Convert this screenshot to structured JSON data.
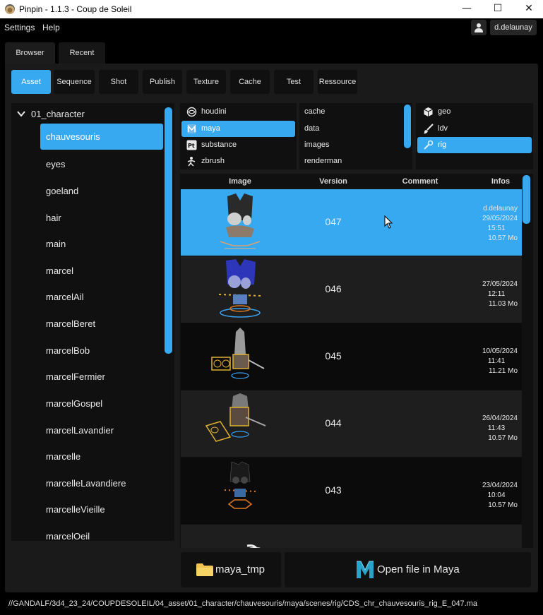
{
  "window": {
    "title": "Pinpin - 1.1.3 - Coup de Soleil",
    "minimize": "—",
    "maximize": "☐",
    "close": "✕"
  },
  "menu": {
    "settings": "Settings",
    "help": "Help"
  },
  "user": {
    "name": "d.delaunay"
  },
  "main_tabs": [
    {
      "label": "Browser",
      "active": true
    },
    {
      "label": "Recent",
      "active": false
    }
  ],
  "categories": [
    {
      "label": "Asset",
      "active": true
    },
    {
      "label": "Sequence"
    },
    {
      "label": "Shot"
    },
    {
      "label": "Publish"
    },
    {
      "label": "Texture"
    },
    {
      "label": "Cache"
    },
    {
      "label": "Test"
    },
    {
      "label": "Ressource"
    }
  ],
  "tree": {
    "group": "01_character",
    "items": [
      {
        "label": "chauvesouris",
        "selected": true
      },
      {
        "label": "eyes"
      },
      {
        "label": "goeland"
      },
      {
        "label": "hair"
      },
      {
        "label": "main"
      },
      {
        "label": "marcel"
      },
      {
        "label": "marcelAil"
      },
      {
        "label": "marcelBeret"
      },
      {
        "label": "marcelBob"
      },
      {
        "label": "marcelFermier"
      },
      {
        "label": "marcelGospel"
      },
      {
        "label": "marcelLavandier"
      },
      {
        "label": "marcelle"
      },
      {
        "label": "marcelleLavandiere"
      },
      {
        "label": "marcelleVieille"
      },
      {
        "label": "marcelOeil"
      }
    ]
  },
  "software": [
    {
      "label": "houdini",
      "icon": "houdini-icon"
    },
    {
      "label": "maya",
      "icon": "maya-icon",
      "selected": true
    },
    {
      "label": "substance",
      "icon": "substance-icon"
    },
    {
      "label": "zbrush",
      "icon": "zbrush-icon"
    }
  ],
  "folders": [
    "cache",
    "data",
    "images",
    "renderman"
  ],
  "steps": [
    {
      "label": "geo",
      "icon": "cube-icon"
    },
    {
      "label": "ldv",
      "icon": "brush-icon"
    },
    {
      "label": "rig",
      "icon": "wrench-icon",
      "selected": true
    }
  ],
  "table": {
    "headers": {
      "image": "Image",
      "version": "Version",
      "comment": "Comment",
      "infos": "Infos"
    },
    "rows": [
      {
        "version": "047",
        "user": "d.delaunay",
        "date": "29/05/2024",
        "time": "15:51",
        "size": "10.57 Mo",
        "selected": true
      },
      {
        "version": "046",
        "user": "",
        "date": "27/05/2024",
        "time": "12:11",
        "size": "11.03 Mo"
      },
      {
        "version": "045",
        "user": "",
        "date": "10/05/2024",
        "time": "11:41",
        "size": "11.21 Mo"
      },
      {
        "version": "044",
        "user": "",
        "date": "26/04/2024",
        "time": "11:43",
        "size": "10.57 Mo"
      },
      {
        "version": "043",
        "user": "",
        "date": "23/04/2024",
        "time": "10:04",
        "size": "10.57 Mo"
      }
    ]
  },
  "buttons": {
    "tmp": "maya_tmp",
    "open": "Open file in Maya"
  },
  "status": {
    "path": "//GANDALF/3d4_23_24/COUPDESOLEIL/04_asset/01_character/chauvesouris/maya/scenes/rig/CDS_chr_chauvesouris_rig_E_047.ma"
  },
  "colors": {
    "accent": "#36a9f0",
    "background": "#000000",
    "panel": "#1a1a1a",
    "list": "#101010"
  }
}
